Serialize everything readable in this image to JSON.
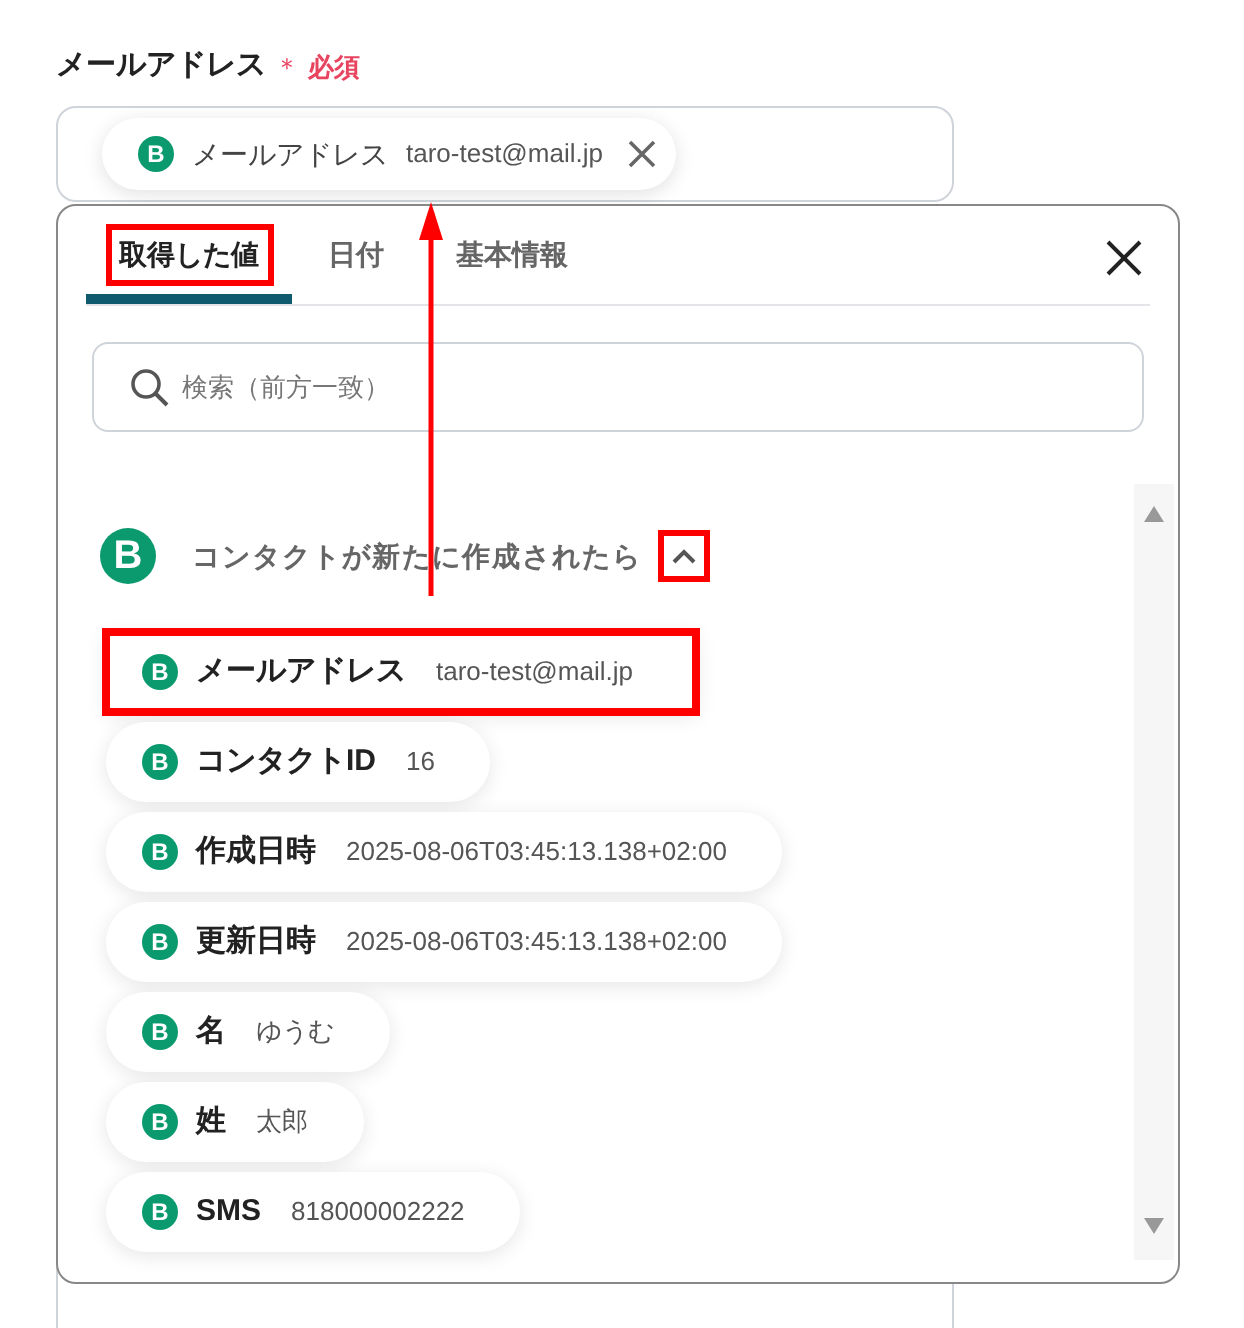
{
  "field": {
    "label": "メールアドレス",
    "required_mark": "＊",
    "required_text": "必須",
    "chip": {
      "icon_text": "B",
      "name": "メールアドレス",
      "value": "taro-test@mail.jp"
    }
  },
  "picker": {
    "tabs": [
      {
        "label": "取得した値",
        "selected": true
      },
      {
        "label": "日付",
        "selected": false
      },
      {
        "label": "基本情報",
        "selected": false
      }
    ],
    "search": {
      "placeholder": "検索（前方一致）"
    },
    "group": {
      "icon_text": "B",
      "title": "コンタクトが新たに作成されたら",
      "expanded": true,
      "items": [
        {
          "icon_text": "B",
          "name": "メールアドレス",
          "value": "taro-test@mail.jp"
        },
        {
          "icon_text": "B",
          "name": "コンタクトID",
          "value": "16"
        },
        {
          "icon_text": "B",
          "name": "作成日時",
          "value": "2025-08-06T03:45:13.138+02:00"
        },
        {
          "icon_text": "B",
          "name": "更新日時",
          "value": "2025-08-06T03:45:13.138+02:00"
        },
        {
          "icon_text": "B",
          "name": "名",
          "value": "ゆうむ"
        },
        {
          "icon_text": "B",
          "name": "姓",
          "value": "太郎"
        },
        {
          "icon_text": "B",
          "name": "SMS",
          "value": "818000002222"
        }
      ]
    }
  }
}
